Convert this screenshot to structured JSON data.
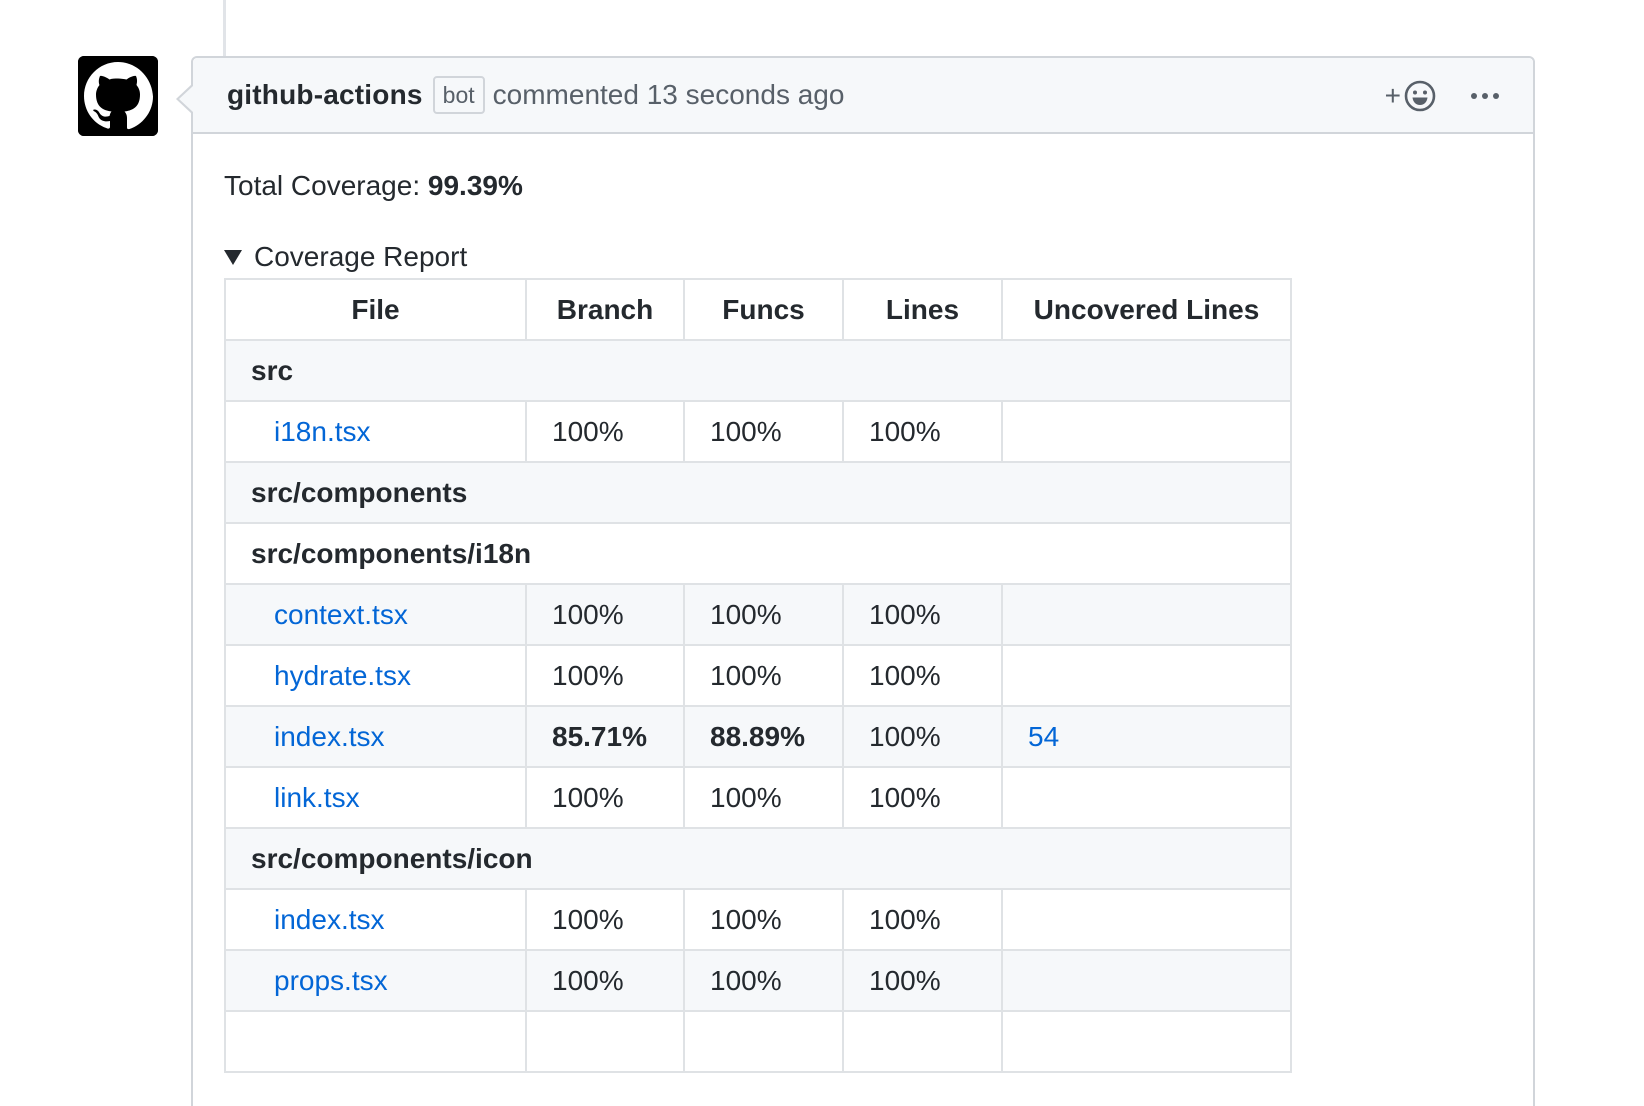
{
  "comment": {
    "author": "github-actions",
    "author_badge": "bot",
    "timestamp_text": "commented 13 seconds ago",
    "reaction_plus": "+",
    "icons": {
      "avatar": "github-octocat-icon",
      "reaction": "smiley-icon",
      "more": "kebab-horizontal-icon"
    }
  },
  "body": {
    "total_label": "Total Coverage: ",
    "total_value": "99.39%",
    "report_summary": "Coverage Report"
  },
  "table": {
    "headers": [
      "File",
      "Branch",
      "Funcs",
      "Lines",
      "Uncovered Lines"
    ],
    "rows": [
      {
        "type": "dir",
        "label": "src"
      },
      {
        "type": "file",
        "file": "i18n.tsx",
        "branch": "100%",
        "funcs": "100%",
        "lines": "100%",
        "uncovered": ""
      },
      {
        "type": "dir",
        "label": "src/components"
      },
      {
        "type": "dir",
        "label": "src/components/i18n"
      },
      {
        "type": "file",
        "file": "context.tsx",
        "branch": "100%",
        "funcs": "100%",
        "lines": "100%",
        "uncovered": ""
      },
      {
        "type": "file",
        "file": "hydrate.tsx",
        "branch": "100%",
        "funcs": "100%",
        "lines": "100%",
        "uncovered": ""
      },
      {
        "type": "file",
        "file": "index.tsx",
        "branch": "85.71%",
        "funcs": "88.89%",
        "lines": "100%",
        "uncovered": "54"
      },
      {
        "type": "file",
        "file": "link.tsx",
        "branch": "100%",
        "funcs": "100%",
        "lines": "100%",
        "uncovered": ""
      },
      {
        "type": "dir",
        "label": "src/components/icon"
      },
      {
        "type": "file",
        "file": "index.tsx",
        "branch": "100%",
        "funcs": "100%",
        "lines": "100%",
        "uncovered": ""
      },
      {
        "type": "file",
        "file": "props.tsx",
        "branch": "100%",
        "funcs": "100%",
        "lines": "100%",
        "uncovered": ""
      },
      {
        "type": "file",
        "file": "",
        "branch": "",
        "funcs": "",
        "lines": "",
        "uncovered": ""
      }
    ]
  },
  "colors": {
    "link": "#0366d6",
    "text": "#24292e",
    "muted": "#586069",
    "border": "#d1d5da",
    "header_bg": "#f6f8fa"
  }
}
